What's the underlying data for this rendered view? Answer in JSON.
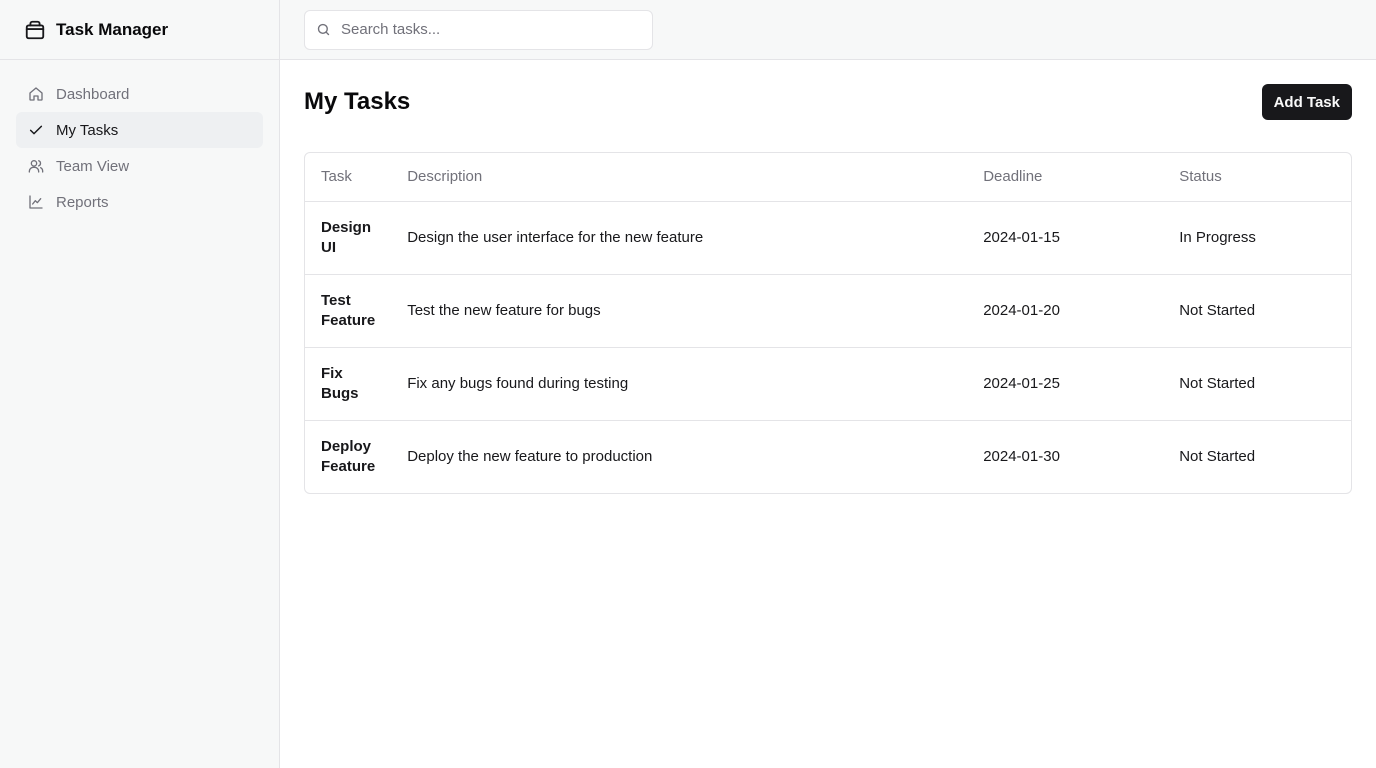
{
  "app": {
    "title": "Task Manager"
  },
  "sidebar": {
    "items": [
      {
        "label": "Dashboard",
        "icon": "home-icon",
        "active": false
      },
      {
        "label": "My Tasks",
        "icon": "check-icon",
        "active": true
      },
      {
        "label": "Team View",
        "icon": "users-icon",
        "active": false
      },
      {
        "label": "Reports",
        "icon": "line-chart-icon",
        "active": false
      }
    ]
  },
  "search": {
    "placeholder": "Search tasks...",
    "value": ""
  },
  "main": {
    "title": "My Tasks",
    "add_button_label": "Add Task"
  },
  "table": {
    "headers": [
      "Task",
      "Description",
      "Deadline",
      "Status"
    ],
    "rows": [
      {
        "task": "Design UI",
        "description": "Design the user interface for the new feature",
        "deadline": "2024-01-15",
        "status": "In Progress"
      },
      {
        "task": "Test Feature",
        "description": "Test the new feature for bugs",
        "deadline": "2024-01-20",
        "status": "Not Started"
      },
      {
        "task": "Fix Bugs",
        "description": "Fix any bugs found during testing",
        "deadline": "2024-01-25",
        "status": "Not Started"
      },
      {
        "task": "Deploy Feature",
        "description": "Deploy the new feature to production",
        "deadline": "2024-01-30",
        "status": "Not Started"
      }
    ]
  },
  "colors": {
    "sidebar_bg": "#f7f8f8",
    "active_item_bg": "#eef0f2",
    "primary_button_bg": "#18181b",
    "muted_text": "#71717a",
    "border": "#e4e4e7"
  }
}
